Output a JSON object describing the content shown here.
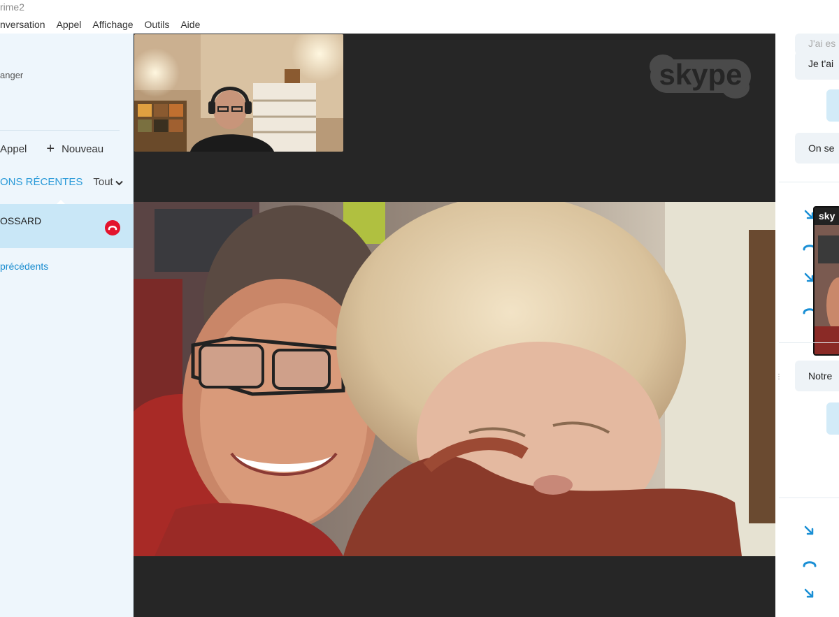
{
  "window": {
    "title": "rime2"
  },
  "menu": [
    "nversation",
    "Appel",
    "Affichage",
    "Outils",
    "Aide"
  ],
  "sidebar": {
    "status": "anger",
    "call_label": "Appel",
    "new_label": "Nouveau",
    "recent_label": "ONS RÉCENTES",
    "filter_label": "Tout",
    "active_contact": "OSSARD",
    "previous_link": "précédents"
  },
  "video": {
    "brand": "skype"
  },
  "chat": {
    "messages": [
      "J'ai es",
      "Je t'ai",
      "On se",
      "Notre"
    ]
  },
  "colors": {
    "accent": "#2a9ad8",
    "end_call": "#e3142d",
    "video_bg": "#262626",
    "sidebar_bg": "#eef6fc"
  }
}
